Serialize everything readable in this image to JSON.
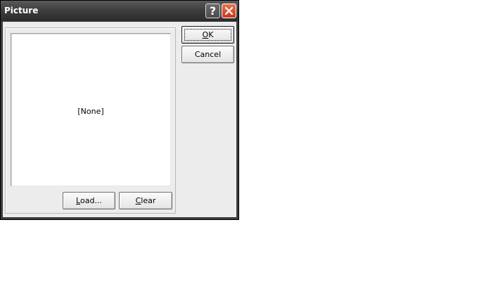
{
  "window": {
    "title": "Picture",
    "help_glyph": "?",
    "close_icon": "close-icon"
  },
  "preview": {
    "placeholder": "[None]"
  },
  "buttons": {
    "load": {
      "mnemonic": "L",
      "rest": "oad..."
    },
    "clear": {
      "mnemonic": "C",
      "rest": "lear"
    },
    "ok": {
      "mnemonic": "O",
      "rest": "K"
    },
    "cancel": "Cancel"
  },
  "colors": {
    "titlebar": "#3e3e3e",
    "close_button": "#d8502c",
    "dialog_face": "#ececec"
  }
}
